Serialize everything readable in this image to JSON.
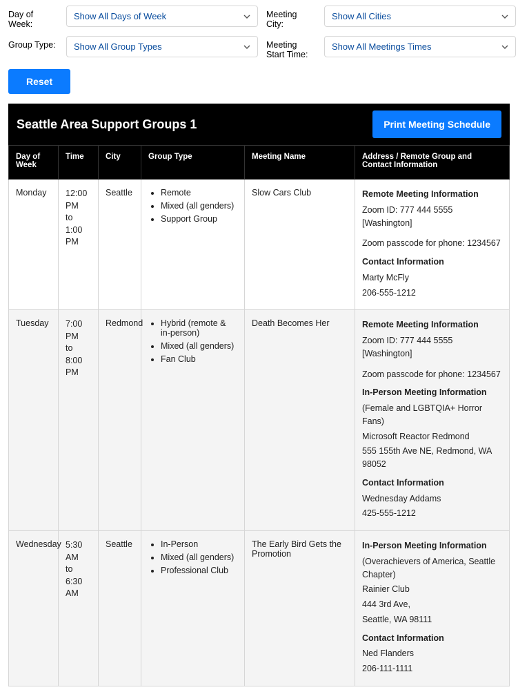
{
  "filters": {
    "day_label": "Day of Week:",
    "day_value": "Show All Days of Week",
    "city_label": "Meeting City:",
    "city_value": "Show All Cities",
    "type_label": "Group Type:",
    "type_value": "Show All Group Types",
    "time_label": "Meeting Start Time:",
    "time_value": "Show All Meetings Times"
  },
  "reset_label": "Reset",
  "title": "Seattle Area Support Groups 1",
  "print_label": "Print Meeting Schedule",
  "columns": {
    "day": "Day of Week",
    "time": "Time",
    "city": "City",
    "type": "Group Type",
    "name": "Meeting Name",
    "info": "Address / Remote Group and Contact Information"
  },
  "rows": [
    {
      "day": "Monday",
      "time_start": "12:00 PM",
      "time_to": "to",
      "time_end": "1:00 PM",
      "city": "Seattle",
      "types": [
        "Remote",
        "Mixed (all genders)",
        "Support Group"
      ],
      "name": "Slow Cars Club",
      "info": [
        {
          "hd": "Remote Meeting Information"
        },
        {
          "ln": "Zoom ID: 777 444 5555 [Washington]"
        },
        {
          "sp": true
        },
        {
          "ln": "Zoom passcode for phone: 1234567"
        },
        {
          "hd": "Contact Information"
        },
        {
          "ln": "Marty McFly"
        },
        {
          "ln": "206-555-1212"
        }
      ]
    },
    {
      "day": "Tuesday",
      "time_start": "7:00 PM",
      "time_to": "to",
      "time_end": "8:00 PM",
      "city": "Redmond",
      "types": [
        "Hybrid (remote & in-person)",
        "Mixed (all genders)",
        "Fan Club"
      ],
      "name": "Death Becomes Her",
      "info": [
        {
          "hd": "Remote Meeting Information"
        },
        {
          "ln": "Zoom ID: 777 444 5555 [Washington]"
        },
        {
          "sp": true
        },
        {
          "ln": "Zoom passcode for phone: 1234567"
        },
        {
          "hd": "In-Person Meeting Information"
        },
        {
          "ln": "(Female and LGBTQIA+ Horror Fans)"
        },
        {
          "ln": "Microsoft Reactor Redmond"
        },
        {
          "ln": "555 155th Ave NE, Redmond, WA 98052"
        },
        {
          "hd": "Contact Information"
        },
        {
          "ln": "Wednesday Addams"
        },
        {
          "ln": "425-555-1212"
        }
      ]
    },
    {
      "day": "Wednesday",
      "time_start": "5:30 AM",
      "time_to": "to",
      "time_end": "6:30 AM",
      "city": "Seattle",
      "types": [
        "In-Person",
        "Mixed (all genders)",
        "Professional Club"
      ],
      "name": "The Early Bird Gets the Promotion",
      "info": [
        {
          "hd": "In-Person Meeting Information"
        },
        {
          "ln": "(Overachievers of America, Seattle Chapter)"
        },
        {
          "ln": "Rainier Club"
        },
        {
          "ln": "444 3rd Ave,"
        },
        {
          "ln": "Seattle, WA 98111"
        },
        {
          "hd": "Contact Information"
        },
        {
          "ln": "Ned Flanders"
        },
        {
          "ln": "206-111-1111"
        }
      ]
    }
  ]
}
